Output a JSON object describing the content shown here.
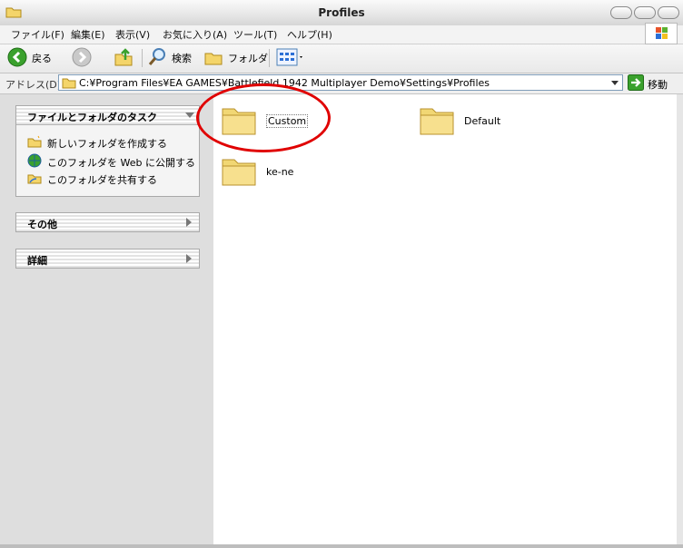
{
  "window": {
    "title": "Profiles"
  },
  "menu": {
    "items": [
      "ファイル(F)",
      "編集(E)",
      "表示(V)",
      "お気に入り(A)",
      "ツール(T)",
      "ヘルプ(H)"
    ]
  },
  "toolbar": {
    "back_label": "戻る",
    "search_label": "検索",
    "folders_label": "フォルダ"
  },
  "address": {
    "label": "アドレス(D)",
    "path": "C:¥Program Files¥EA GAMES¥Battlefield 1942 Multiplayer Demo¥Settings¥Profiles",
    "go_label": "移動"
  },
  "sidebar": {
    "tasks_title": "ファイルとフォルダのタスク",
    "tasks": [
      "新しいフォルダを作成する",
      "このフォルダを Web に公開する",
      "このフォルダを共有する"
    ],
    "other_title": "その他",
    "details_title": "詳細"
  },
  "folders": [
    {
      "name": "Custom"
    },
    {
      "name": "Default"
    },
    {
      "name": "ke-ne"
    }
  ],
  "colors": {
    "accent_green": "#3aa12d",
    "folder_yellow": "#f1d774",
    "highlight_red": "#e00000",
    "panel_bg": "#dedede"
  }
}
